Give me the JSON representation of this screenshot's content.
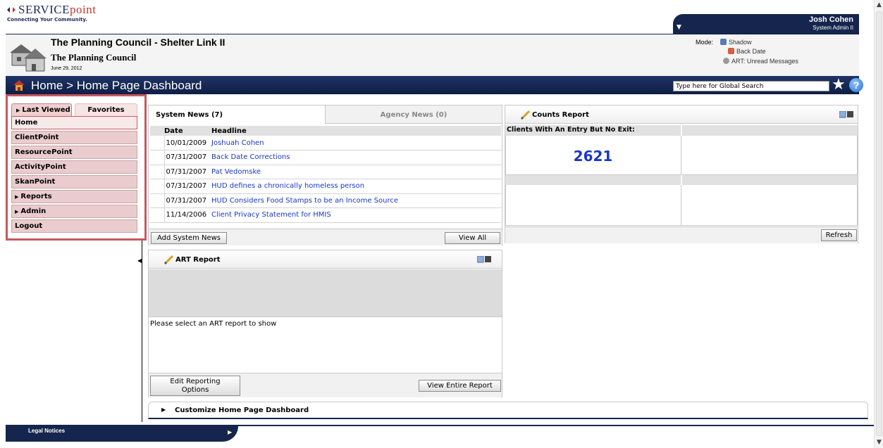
{
  "brand": {
    "name_left": "SERVICE",
    "name_right": "point",
    "tagline": "Connecting Your Community."
  },
  "user": {
    "name": "Josh Cohen",
    "role": "System Admin II"
  },
  "org": {
    "title": "The Planning Council - Shelter Link II",
    "name": "The Planning Council",
    "date": "June 29, 2012"
  },
  "mode": {
    "label": "Mode:",
    "items": [
      {
        "label": "Shadow",
        "icon": "shadow-icon",
        "color": "#5a7bb0"
      },
      {
        "label": "Back Date",
        "icon": "back-date-icon",
        "color": "#d06040"
      },
      {
        "label": "ART: Unread Messages",
        "icon": "art-messages-icon",
        "color": "#9a9a9a"
      }
    ]
  },
  "titlebar": {
    "breadcrumb": "Home > Home Page Dashboard",
    "search_value": "Type here for Global Search"
  },
  "sidebar": {
    "tabs": [
      {
        "label": "Last Viewed"
      },
      {
        "label": "Favorites"
      }
    ],
    "items": [
      {
        "label": "Home",
        "active": true
      },
      {
        "label": "ClientPoint"
      },
      {
        "label": "ResourcePoint"
      },
      {
        "label": "ActivityPoint"
      },
      {
        "label": "SkanPoint"
      },
      {
        "label": "Reports",
        "expandable": true
      },
      {
        "label": "Admin",
        "expandable": true
      },
      {
        "label": "Logout"
      }
    ]
  },
  "news": {
    "tab_system": "System News (7)",
    "tab_agency": "Agency News (0)",
    "col_date": "Date",
    "col_headline": "Headline",
    "rows": [
      {
        "date": "10/01/2009",
        "headline": "Joshuah Cohen"
      },
      {
        "date": "07/31/2007",
        "headline": "Back Date Corrections"
      },
      {
        "date": "07/31/2007",
        "headline": "Pat Vedomske"
      },
      {
        "date": "07/31/2007",
        "headline": "HUD defines a chronically homeless person"
      },
      {
        "date": "07/31/2007",
        "headline": "HUD Considers Food Stamps to be an Income Source"
      },
      {
        "date": "11/14/2006",
        "headline": "Client Privacy Statement for HMIS"
      }
    ],
    "add_button": "Add System News",
    "view_all_button": "View All"
  },
  "counts": {
    "title": "Counts Report",
    "header": "Clients With An Entry But No Exit:",
    "value": "2621",
    "refresh_button": "Refresh"
  },
  "art": {
    "title": "ART Report",
    "message": "Please select an ART report to show",
    "edit_button_line1": "Edit Reporting",
    "edit_button_line2": "Options",
    "view_button": "View Entire Report"
  },
  "customize": {
    "label": "Customize Home Page Dashboard"
  },
  "footer": {
    "legal": "Legal Notices"
  },
  "colors": {
    "navy": "#15254d",
    "sidebar_border": "#c8585f",
    "sidebar_item": "#eaccce",
    "link": "#1a37c5"
  }
}
